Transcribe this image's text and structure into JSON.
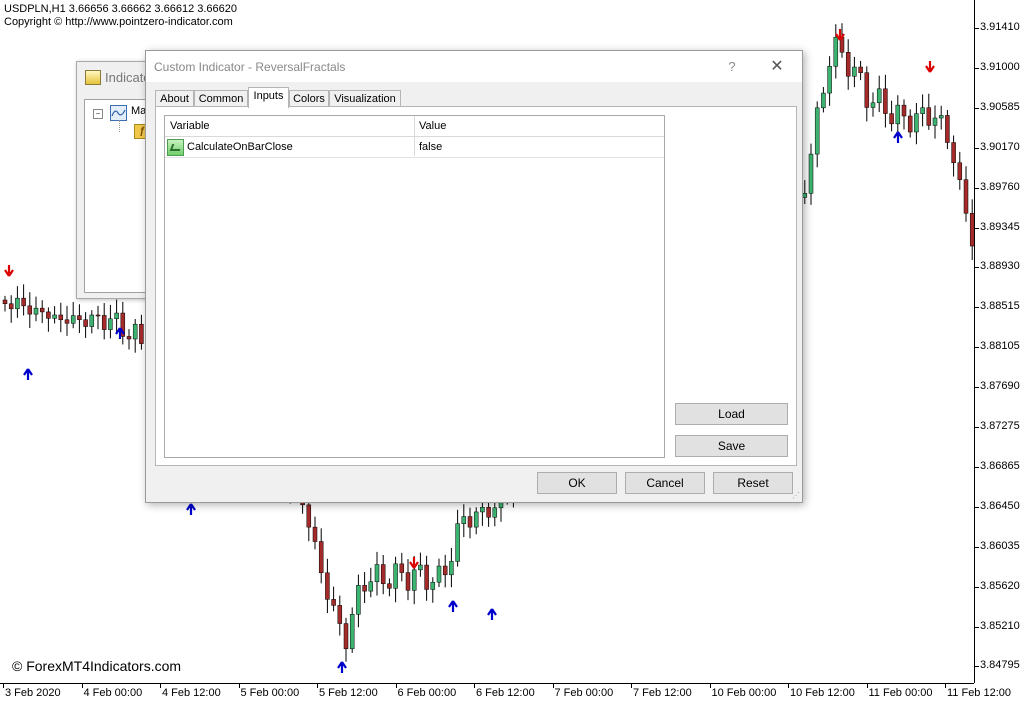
{
  "chart": {
    "symbol_line": "USDPLN,H1  3.66656 3.66662 3.66612 3.66620",
    "copyright": "Copyright © http://www.pointzero-indicator.com",
    "watermark": "© ForexMT4Indicators.com",
    "price_labels": [
      "3.91410",
      "3.91000",
      "3.90585",
      "3.90170",
      "3.89760",
      "3.89345",
      "3.88930",
      "3.88515",
      "3.88105",
      "3.87690",
      "3.87275",
      "3.86865",
      "3.86450",
      "3.86035",
      "3.85620",
      "3.85210",
      "3.84795"
    ],
    "time_labels": [
      "3 Feb 2020",
      "4 Feb 00:00",
      "4 Feb 12:00",
      "5 Feb 00:00",
      "5 Feb 12:00",
      "6 Feb 00:00",
      "6 Feb 12:00",
      "7 Feb 00:00",
      "7 Feb 12:00",
      "10 Feb 00:00",
      "10 Feb 12:00",
      "11 Feb 00:00",
      "11 Feb 12:00"
    ],
    "colors": {
      "bull": "#3cb371",
      "bear": "#a52a2a",
      "up_arrow": "#0000cd",
      "down_arrow": "#dd0000"
    }
  },
  "bg_window": {
    "title": "Indicato",
    "tree_item": "Ma",
    "icons": [
      "indicator-folder-icon",
      "moving-average-icon",
      "custom-indicator-icon"
    ]
  },
  "dialog": {
    "title": "Custom Indicator - ReversalFractals",
    "help_label": "?",
    "close_label": "✕",
    "tabs": [
      {
        "label": "About",
        "active": false
      },
      {
        "label": "Common",
        "active": false
      },
      {
        "label": "Inputs",
        "active": true
      },
      {
        "label": "Colors",
        "active": false
      },
      {
        "label": "Visualization",
        "active": false
      }
    ],
    "grid": {
      "headers": {
        "variable": "Variable",
        "value": "Value"
      },
      "rows": [
        {
          "variable": "CalculateOnBarClose",
          "value": "false"
        }
      ]
    },
    "buttons": {
      "load": "Load",
      "save": "Save",
      "ok": "OK",
      "cancel": "Cancel",
      "reset": "Reset"
    }
  }
}
